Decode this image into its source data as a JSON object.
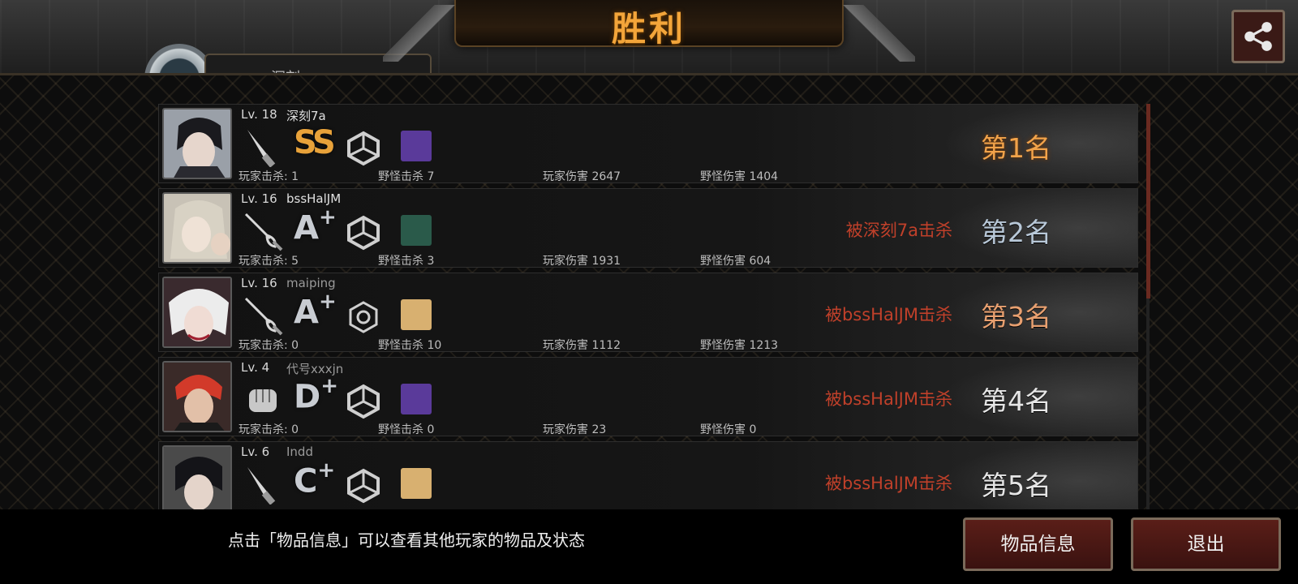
{
  "header": {
    "title": "胜利",
    "player_tab_name": "深刻"
  },
  "players": [
    {
      "level": "Lv. 18",
      "name": "深刻7a",
      "weapon": "knife-icon",
      "grade_main": "SS",
      "grade_plus": "",
      "player_kills_label": "玩家击杀: 1",
      "monster_kills_label": "野怪击杀 7",
      "player_damage_label": "玩家伤害 2647",
      "monster_damage_label": "野怪伤害 1404",
      "killed_by": "",
      "rank": "第1名",
      "item_color": "#5a3a9a"
    },
    {
      "level": "Lv. 16",
      "name": "bssHalJM",
      "weapon": "rapier-icon",
      "grade_main": "A",
      "grade_plus": "+",
      "player_kills_label": "玩家击杀: 5",
      "monster_kills_label": "野怪击杀 3",
      "player_damage_label": "玩家伤害 1931",
      "monster_damage_label": "野怪伤害 604",
      "killed_by": "被深刻7a击杀",
      "rank": "第2名",
      "item_color": "#2a5a4a"
    },
    {
      "level": "Lv. 16",
      "name": "maiping",
      "weapon": "rapier-icon",
      "grade_main": "A",
      "grade_plus": "+",
      "player_kills_label": "玩家击杀: 0",
      "monster_kills_label": "野怪击杀 10",
      "player_damage_label": "玩家伤害 1112",
      "monster_damage_label": "野怪伤害 1213",
      "killed_by": "被bssHalJM击杀",
      "rank": "第3名",
      "item_color": "#d8b070"
    },
    {
      "level": "Lv. 4",
      "name": "代号xxxjn",
      "weapon": "fist-icon",
      "grade_main": "D",
      "grade_plus": "+",
      "player_kills_label": "玩家击杀: 0",
      "monster_kills_label": "野怪击杀 0",
      "player_damage_label": "玩家伤害 23",
      "monster_damage_label": "野怪伤害 0",
      "killed_by": "被bssHalJM击杀",
      "rank": "第4名",
      "item_color": "#5a3a9a"
    },
    {
      "level": "Lv. 6",
      "name": "Indd",
      "weapon": "knife-icon",
      "grade_main": "C",
      "grade_plus": "+",
      "player_kills_label": "",
      "monster_kills_label": "",
      "player_damage_label": "",
      "monster_damage_label": "",
      "killed_by": "被bssHalJM击杀",
      "rank": "第5名",
      "item_color": "#d8b070"
    }
  ],
  "footer": {
    "hint": "点击「物品信息」可以查看其他玩家的物品及状态",
    "items_button": "物品信息",
    "exit_button": "退出"
  },
  "colors": {
    "accent": "#f3a53a",
    "killed_red": "#c0402a",
    "button_bg": "#5a1e18"
  }
}
